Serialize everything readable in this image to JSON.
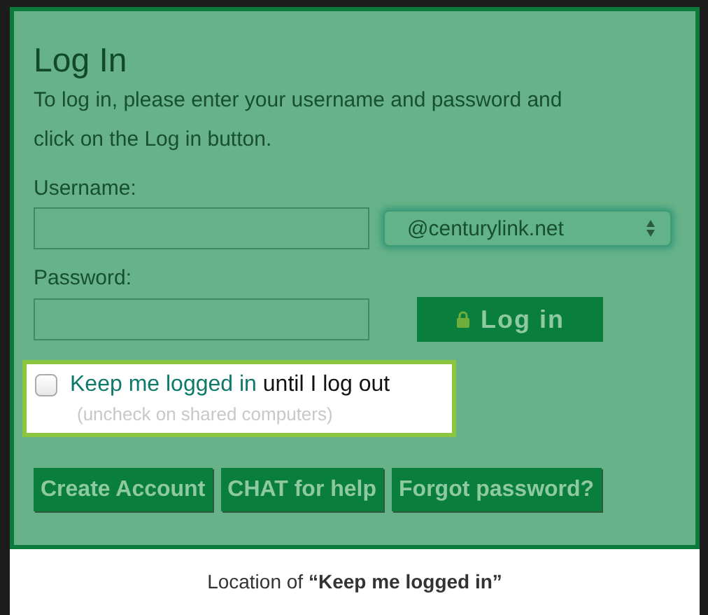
{
  "panel": {
    "title": "Log In",
    "intro": "To log in, please enter your username and password and click on the Log in button.",
    "username": {
      "label": "Username:",
      "domain": "@centurylink.net"
    },
    "password": {
      "label": "Password:"
    },
    "login_button": "Log in",
    "keep_logged_in": {
      "checked": false,
      "label": "Keep me logged in",
      "label_rest": "until I log out",
      "hint": "(uncheck on shared computers)"
    },
    "buttons": [
      "Create Account",
      "CHAT for help",
      "Forgot password?"
    ]
  },
  "caption": "Location of **“Keep me logged in”**"
}
